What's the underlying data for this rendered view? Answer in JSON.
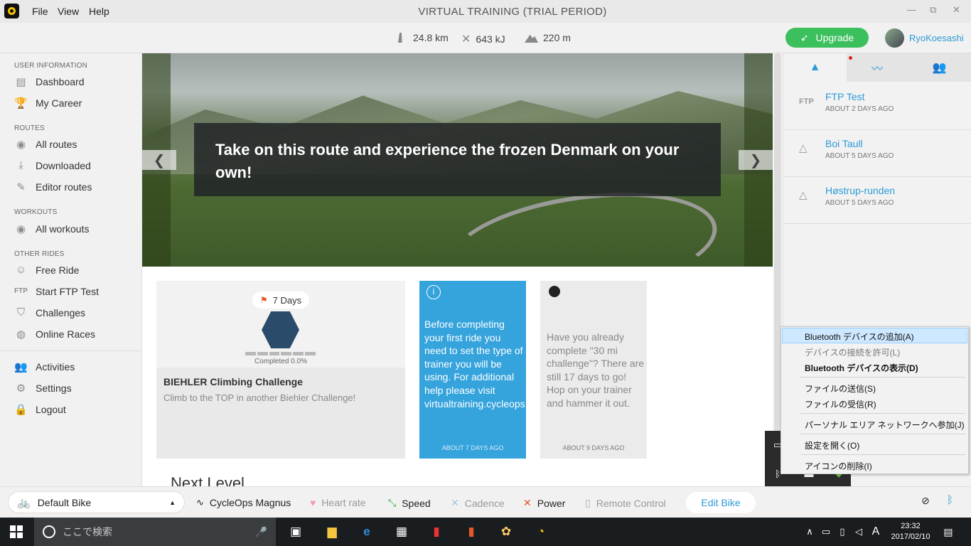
{
  "titlebar": {
    "menu": [
      "File",
      "View",
      "Help"
    ],
    "title": "VIRTUAL TRAINING (TRIAL PERIOD)",
    "controls": [
      "—",
      "⧉",
      "✕"
    ]
  },
  "stats": {
    "distance": "24.8 km",
    "energy": "643 kJ",
    "elevation": "220 m"
  },
  "upgrade_label": "Upgrade",
  "username": "RyoKoesashi",
  "sidebar": {
    "user_info": "USER INFORMATION",
    "dashboard": "Dashboard",
    "career": "My Career",
    "routes": "ROUTES",
    "all_routes": "All routes",
    "downloaded": "Downloaded",
    "editor_routes": "Editor routes",
    "workouts": "WORKOUTS",
    "all_workouts": "All workouts",
    "other_rides": "OTHER RIDES",
    "free_ride": "Free Ride",
    "ftp_prefix": "FTP",
    "ftp_test": "Start FTP Test",
    "challenges": "Challenges",
    "online_races": "Online Races",
    "activities": "Activities",
    "settings": "Settings",
    "logout": "Logout"
  },
  "hero": {
    "caption": "Take on this route and experience the frozen Denmark on your own!",
    "prev": "❮",
    "next": "❯"
  },
  "cards": {
    "challenge": {
      "badge": "7 Days",
      "completed": "Completed 0.0%",
      "title": "BIEHLER Climbing Challenge",
      "desc": "Climb to the TOP in another Biehler Challenge!",
      "progress": 0.0
    },
    "info": {
      "icon": "i",
      "text": "Before completing your first ride you need to set the type of trainer you will be using. For additional help please visit virtualtraining.cycleops.com.",
      "ago": "ABOUT 7 DAYS AGO"
    },
    "challenge2": {
      "text": "Have you already complete \"30 mi challenge\"? There are still 17 days to go! Hop on your trainer and hammer it out.",
      "ago": "ABOUT 9 DAYS AGO"
    }
  },
  "next_level": "Next Level",
  "right_panel": {
    "tabs": [
      "mountain-icon",
      "pulse-icon",
      "people-icon"
    ],
    "items": [
      {
        "icon": "FTP",
        "name": "FTP Test",
        "ago": "ABOUT 2 DAYS AGO"
      },
      {
        "icon": "mountain",
        "name": "Boi Taull",
        "ago": "ABOUT 5 DAYS AGO"
      },
      {
        "icon": "mountain",
        "name": "Høstrup-runden",
        "ago": "ABOUT 5 DAYS AGO"
      }
    ]
  },
  "context_menu": {
    "add": "Bluetooth デバイスの追加(A)",
    "allow": "デバイスの接続を許可(L)",
    "show": "Bluetooth デバイスの表示(D)",
    "send": "ファイルの送信(S)",
    "receive": "ファイルの受信(R)",
    "pan": "パーソナル エリア ネットワークへ参加(J)",
    "settings": "設定を開く(O)",
    "remove": "アイコンの削除(I)"
  },
  "bottom": {
    "bike": "Default Bike",
    "trainer": "CycleOps Magnus",
    "heart": "Heart rate",
    "speed": "Speed",
    "cadence": "Cadence",
    "power": "Power",
    "remote": "Remote Control",
    "edit_bike": "Edit Bike"
  },
  "taskbar": {
    "search_placeholder": "ここで検索",
    "time": "23:32",
    "date": "2017/02/10",
    "ime": "A"
  },
  "colors": {
    "accent": "#2d9bd6",
    "upgrade": "#3cc05e",
    "info_card": "#35a3dc"
  }
}
